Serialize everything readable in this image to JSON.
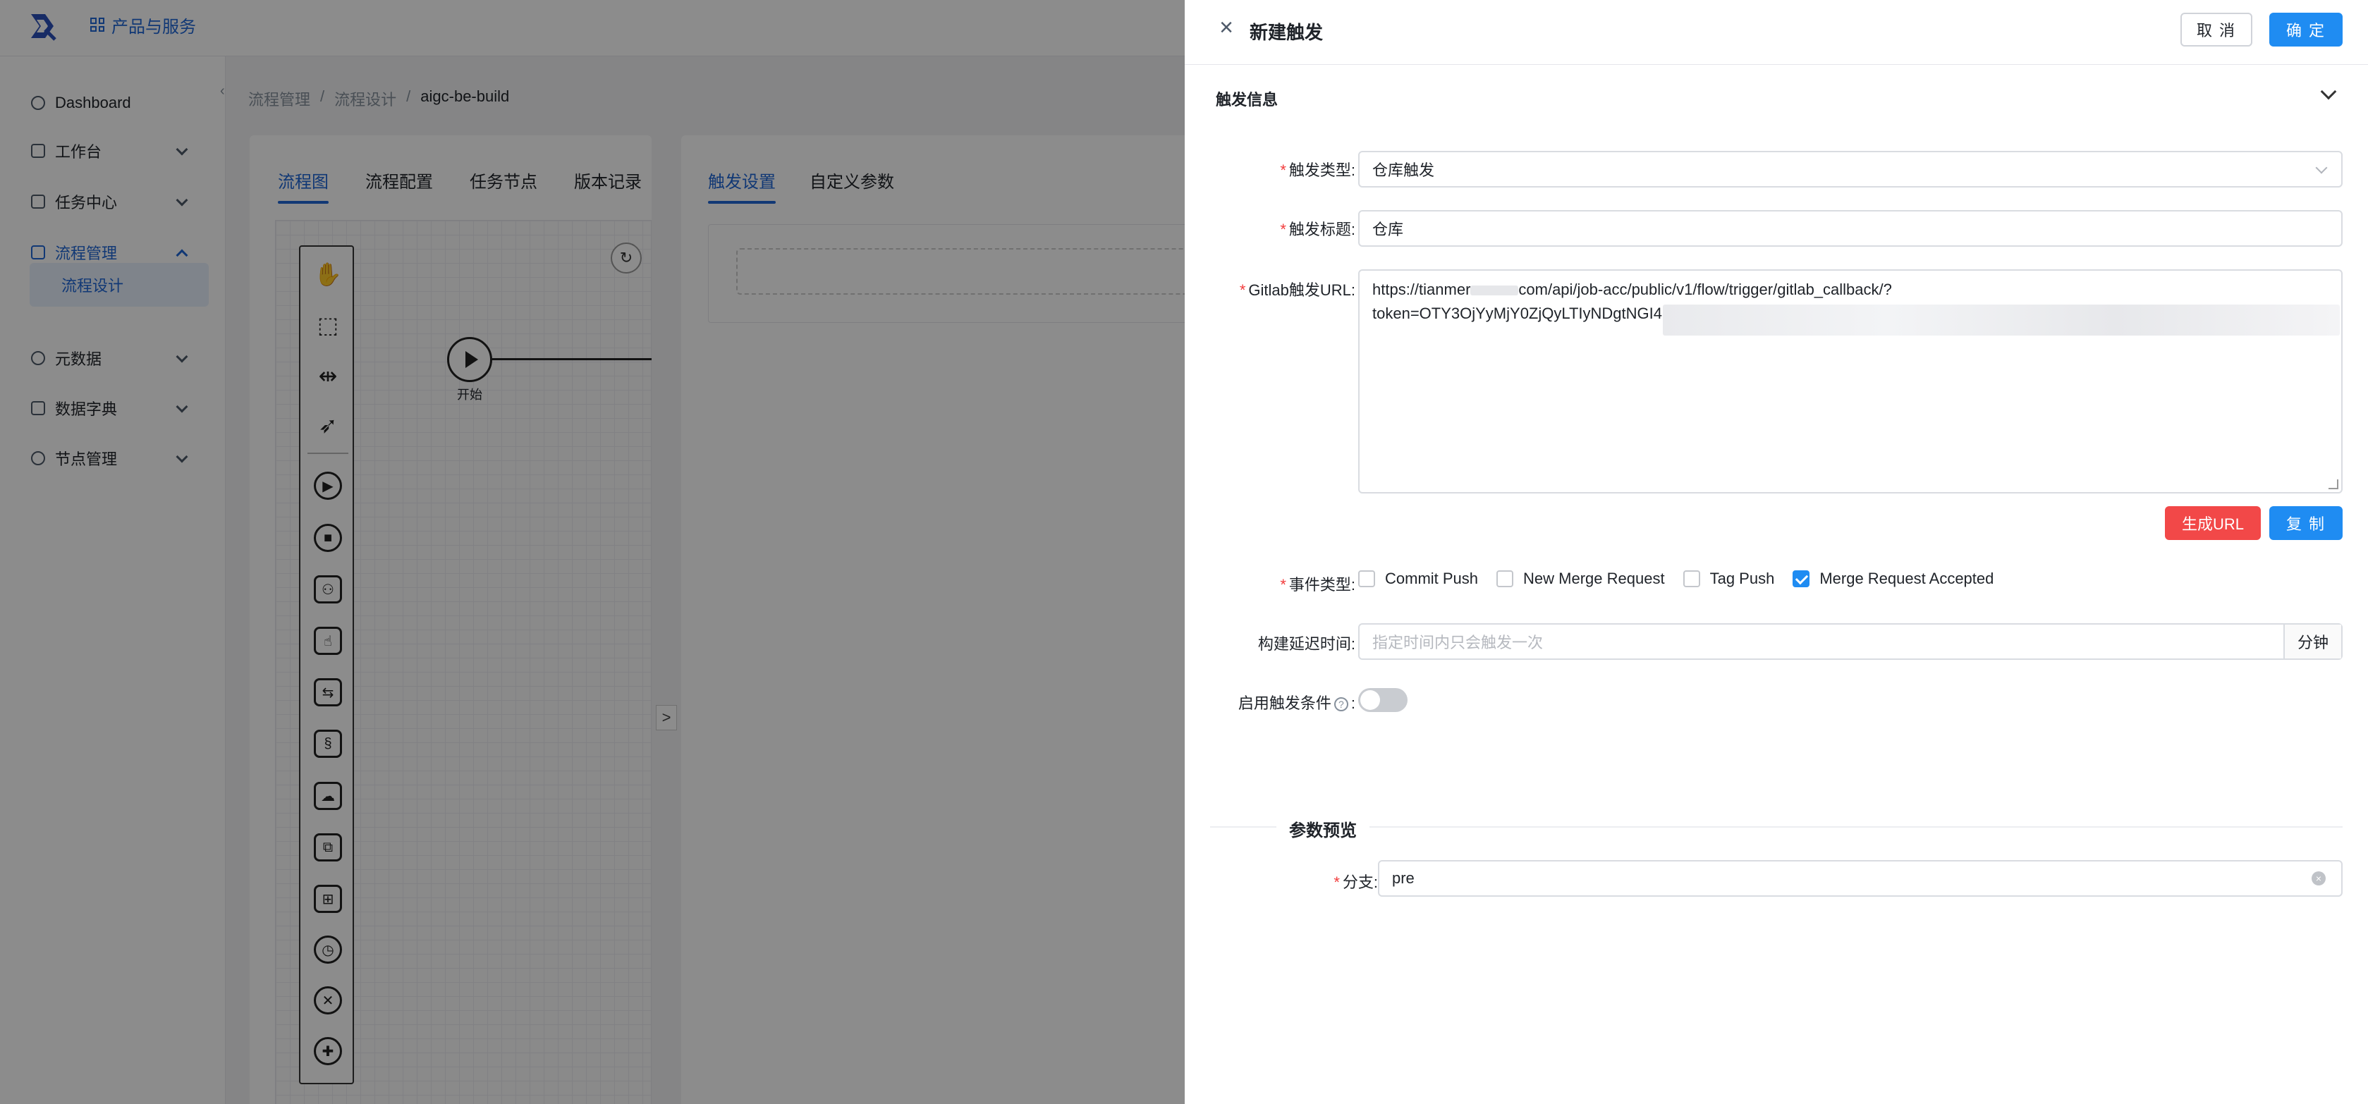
{
  "topbar": {
    "product_link": "产品与服务"
  },
  "sidebar": {
    "items": [
      {
        "label": "Dashboard"
      },
      {
        "label": "工作台"
      },
      {
        "label": "任务中心"
      },
      {
        "label": "流程管理"
      },
      {
        "label": "元数据"
      },
      {
        "label": "数据字典"
      },
      {
        "label": "节点管理"
      }
    ],
    "sub_item": "流程设计",
    "collapse_glyph": "‹"
  },
  "breadcrumb": {
    "items": [
      "流程管理",
      "/",
      "流程设计",
      "/",
      "aigc-be-build"
    ]
  },
  "left_panel": {
    "tabs": [
      "流程图",
      "流程配置",
      "任务节点",
      "版本记录"
    ],
    "start_node_label": "开始",
    "expander_glyph": ">"
  },
  "right_panel": {
    "tabs": [
      "触发设置",
      "自定义参数"
    ]
  },
  "drawer": {
    "close_glyph": "×",
    "title": "新建触发",
    "cancel_label": "取 消",
    "ok_label": "确 定",
    "section_title": "触发信息",
    "fields": {
      "trigger_type": {
        "label": "触发类型:",
        "value": "仓库触发"
      },
      "trigger_title": {
        "label": "触发标题:",
        "value": "仓库"
      },
      "gitlab_url": {
        "label": "Gitlab触发URL:",
        "line1_prefix": "https://tianmer",
        "line1_suffix": "com/api/job-acc/public/v1/flow/trigger/gitlab_callback/?",
        "line2": "token=OTY3OjYyMjY0ZjQyLTIyNDgtNGI4I"
      },
      "generate_url_label": "生成URL",
      "copy_label": "复 制",
      "event_type": {
        "label": "事件类型:",
        "options": [
          {
            "label": "Commit Push",
            "checked": false
          },
          {
            "label": "New Merge Request",
            "checked": false
          },
          {
            "label": "Tag Push",
            "checked": false
          },
          {
            "label": "Merge Request Accepted",
            "checked": true
          }
        ]
      },
      "build_delay": {
        "label": "构建延迟时间:",
        "placeholder": "指定时间内只会触发一次",
        "unit": "分钟"
      },
      "enable_condition": {
        "label": "启用触发条件",
        "help": "?",
        "colon": ":",
        "enabled": false
      }
    },
    "preview": {
      "title": "参数预览",
      "branch": {
        "label": "分支:",
        "value": "pre",
        "clear_glyph": "×"
      }
    }
  },
  "colors": {
    "primary": "#1f8cf2",
    "danger": "#f24848",
    "required": "#f23c3c",
    "nav_active": "#1f66d6"
  }
}
